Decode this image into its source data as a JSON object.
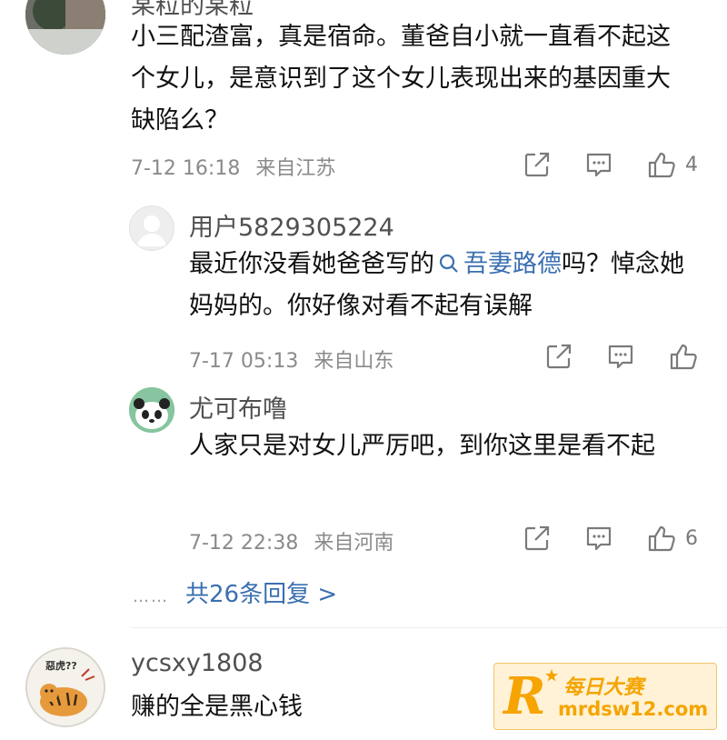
{
  "top_comment": {
    "username_partial": "某粒的某粒",
    "text": "小三配渣富，真是宿命。董爸自小就一直看不起这个女儿，是意识到了这个女儿表现出来的基因重大缺陷么？",
    "time": "7-12 16:18",
    "location": "来自江苏",
    "like_count": "4"
  },
  "replies": [
    {
      "username": "用户5829305224",
      "text_before": "最近你没看她爸爸写的",
      "topic_icon": "search-icon",
      "topic": "吾妻路德",
      "text_after": "吗？悼念她妈妈的。你好像对看不起有误解",
      "time": "7-17 05:13",
      "location": "来自山东",
      "like_count": ""
    },
    {
      "username": "尤可布噜",
      "text": "人家只是对女儿严厉吧，到你这里是看不起",
      "time": "7-12 22:38",
      "location": "来自河南",
      "like_count": "6"
    }
  ],
  "more_replies": {
    "dots": "……",
    "label": "共26条回复 >"
  },
  "next_comment": {
    "username": "ycsxy1808",
    "text": "赚的全是黑心钱",
    "avatar_caption": "惡虎??"
  },
  "watermark": {
    "logo_letter": "R",
    "title": "每日大赛",
    "url": "mrdsw12.com"
  },
  "colors": {
    "link": "#3a6fb0",
    "meta": "#8a8a8a",
    "watermark": "#f5a400"
  }
}
